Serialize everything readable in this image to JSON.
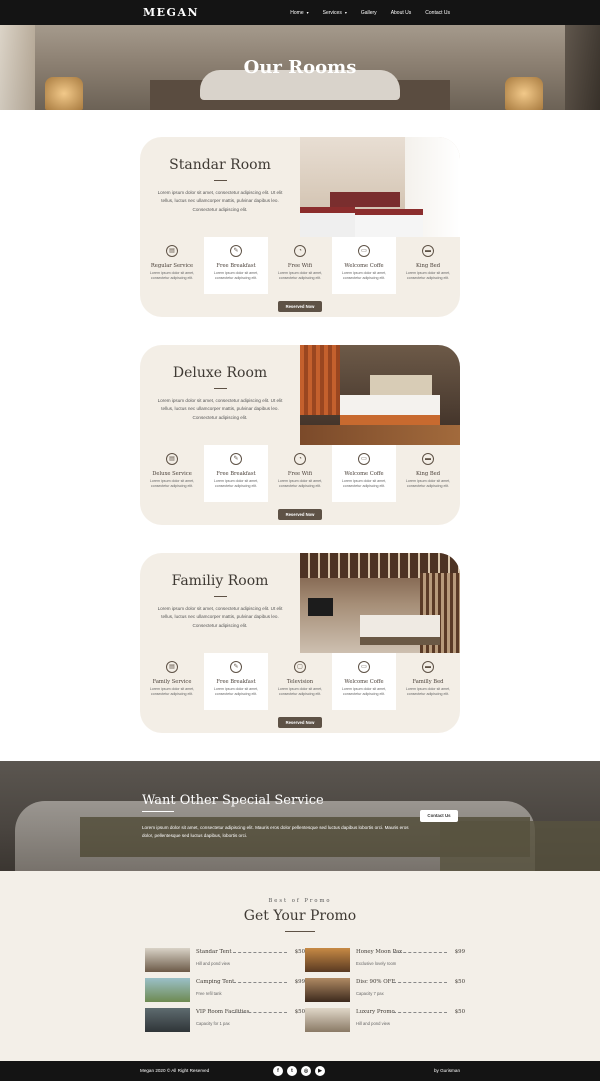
{
  "brand": "MEGAN",
  "nav": {
    "items": [
      {
        "label": "Home",
        "caret": "▾"
      },
      {
        "label": "Services",
        "caret": "▾"
      },
      {
        "label": "Gallery",
        "caret": ""
      },
      {
        "label": "About Us",
        "caret": ""
      },
      {
        "label": "Contact Us",
        "caret": ""
      }
    ]
  },
  "hero": {
    "title": "Our Rooms"
  },
  "rooms": [
    {
      "title": "Standar Room",
      "description": "Lorem ipsum dolor sit amet, consectetur adipiscing elit. Ut elit tellus, luctus nec ullamcorper mattis, pulvinar dapibus leo. Consectetur adipiscing elit.",
      "amenities": [
        {
          "icon": "service-icon",
          "glyph": "▤",
          "name": "Regular Service",
          "desc": "Lorem ipsum dolor sit amet, consectetur adipiscing elit."
        },
        {
          "icon": "breakfast-icon",
          "glyph": "✎",
          "name": "Free Breakfast",
          "desc": "Lorem ipsum dolor sit amet, consectetur adipiscing elit."
        },
        {
          "icon": "wifi-icon",
          "glyph": "◔",
          "name": "Free Wifi",
          "desc": "Lorem ipsum dolor sit amet, consectetur adipiscing elit."
        },
        {
          "icon": "coffee-icon",
          "glyph": "▭",
          "name": "Welcome Coffe",
          "desc": "Lorem ipsum dolor sit amet, consectetur adipiscing elit."
        },
        {
          "icon": "bed-icon",
          "glyph": "▬",
          "name": "King Bed",
          "desc": "Lorem ipsum dolor sit amet, consectetur adipiscing elit."
        }
      ],
      "button": "Reserved Now"
    },
    {
      "title": "Deluxe Room",
      "description": "Lorem ipsum dolor sit amet, consectetur adipiscing elit. Ut elit tellus, luctus nec ullamcorper mattis, pulvinar dapibus leo. Consectetur adipiscing elit.",
      "amenities": [
        {
          "icon": "service-icon",
          "glyph": "▤",
          "name": "Deluxe Service",
          "desc": "Lorem ipsum dolor sit amet, consectetur adipiscing elit."
        },
        {
          "icon": "breakfast-icon",
          "glyph": "✎",
          "name": "Free Breakfast",
          "desc": "Lorem ipsum dolor sit amet, consectetur adipiscing elit."
        },
        {
          "icon": "wifi-icon",
          "glyph": "◔",
          "name": "Free Wifi",
          "desc": "Lorem ipsum dolor sit amet, consectetur adipiscing elit."
        },
        {
          "icon": "coffee-icon",
          "glyph": "▭",
          "name": "Welcome Coffe",
          "desc": "Lorem ipsum dolor sit amet, consectetur adipiscing elit."
        },
        {
          "icon": "bed-icon",
          "glyph": "▬",
          "name": "King Bed",
          "desc": "Lorem ipsum dolor sit amet, consectetur adipiscing elit."
        }
      ],
      "button": "Reserved Now"
    },
    {
      "title": "Familiy Room",
      "description": "Lorem ipsum dolor sit amet, consectetur adipiscing elit. Ut elit tellus, luctus nec ullamcorper mattis, pulvinar dapibus leo. Consectetur adipiscing elit.",
      "amenities": [
        {
          "icon": "service-icon",
          "glyph": "▤",
          "name": "Family Service",
          "desc": "Lorem ipsum dolor sit amet, consectetur adipiscing elit."
        },
        {
          "icon": "breakfast-icon",
          "glyph": "✎",
          "name": "Free Breakfast",
          "desc": "Lorem ipsum dolor sit amet, consectetur adipiscing elit."
        },
        {
          "icon": "tv-icon",
          "glyph": "▢",
          "name": "Television",
          "desc": "Lorem ipsum dolor sit amet, consectetur adipiscing elit."
        },
        {
          "icon": "coffee-icon",
          "glyph": "▭",
          "name": "Welcome Coffe",
          "desc": "Lorem ipsum dolor sit amet, consectetur adipiscing elit."
        },
        {
          "icon": "bed-icon",
          "glyph": "▬",
          "name": "Familly Bed",
          "desc": "Lorem ipsum dolor sit amet, consectetur adipiscing elit."
        }
      ],
      "button": "Reserved Now"
    }
  ],
  "special": {
    "title": "Want Other Special Service",
    "text": "Lorem ipsum dolor sit amet, consectetur adipiscing elit. Mauris eros dolor pellentesque sed luctus dapibus lobortis orci. Mauris eros dolor, pellentesque sed luctus dapibus, lobortis orci.",
    "button": "Contact Us"
  },
  "promo": {
    "kicker": "Best of Promo",
    "title": "Get Your Promo",
    "items": [
      {
        "name": "Standar Tent",
        "price": "$50",
        "sub": "Hill and pond view"
      },
      {
        "name": "Honey Moon Pax",
        "price": "$99",
        "sub": "Exclusive lovely room"
      },
      {
        "name": "Camping Tent",
        "price": "$99",
        "sub": "Free refil tank"
      },
      {
        "name": "Disc 90% OFF",
        "price": "$50",
        "sub": "Capacity 7 pax"
      },
      {
        "name": "VIP Room Facilities",
        "price": "$50",
        "sub": "Capacity for 1 pax"
      },
      {
        "name": "Luxury Promo",
        "price": "$50",
        "sub": "Hill and pond view"
      }
    ]
  },
  "footer": {
    "copyright": "Megan 2020 © All Right Reserved",
    "credit": "by Gurisman",
    "socials": [
      {
        "icon": "facebook-icon",
        "glyph": "f"
      },
      {
        "icon": "twitter-icon",
        "glyph": "t"
      },
      {
        "icon": "instagram-icon",
        "glyph": "◎"
      },
      {
        "icon": "youtube-icon",
        "glyph": "▶"
      }
    ]
  }
}
